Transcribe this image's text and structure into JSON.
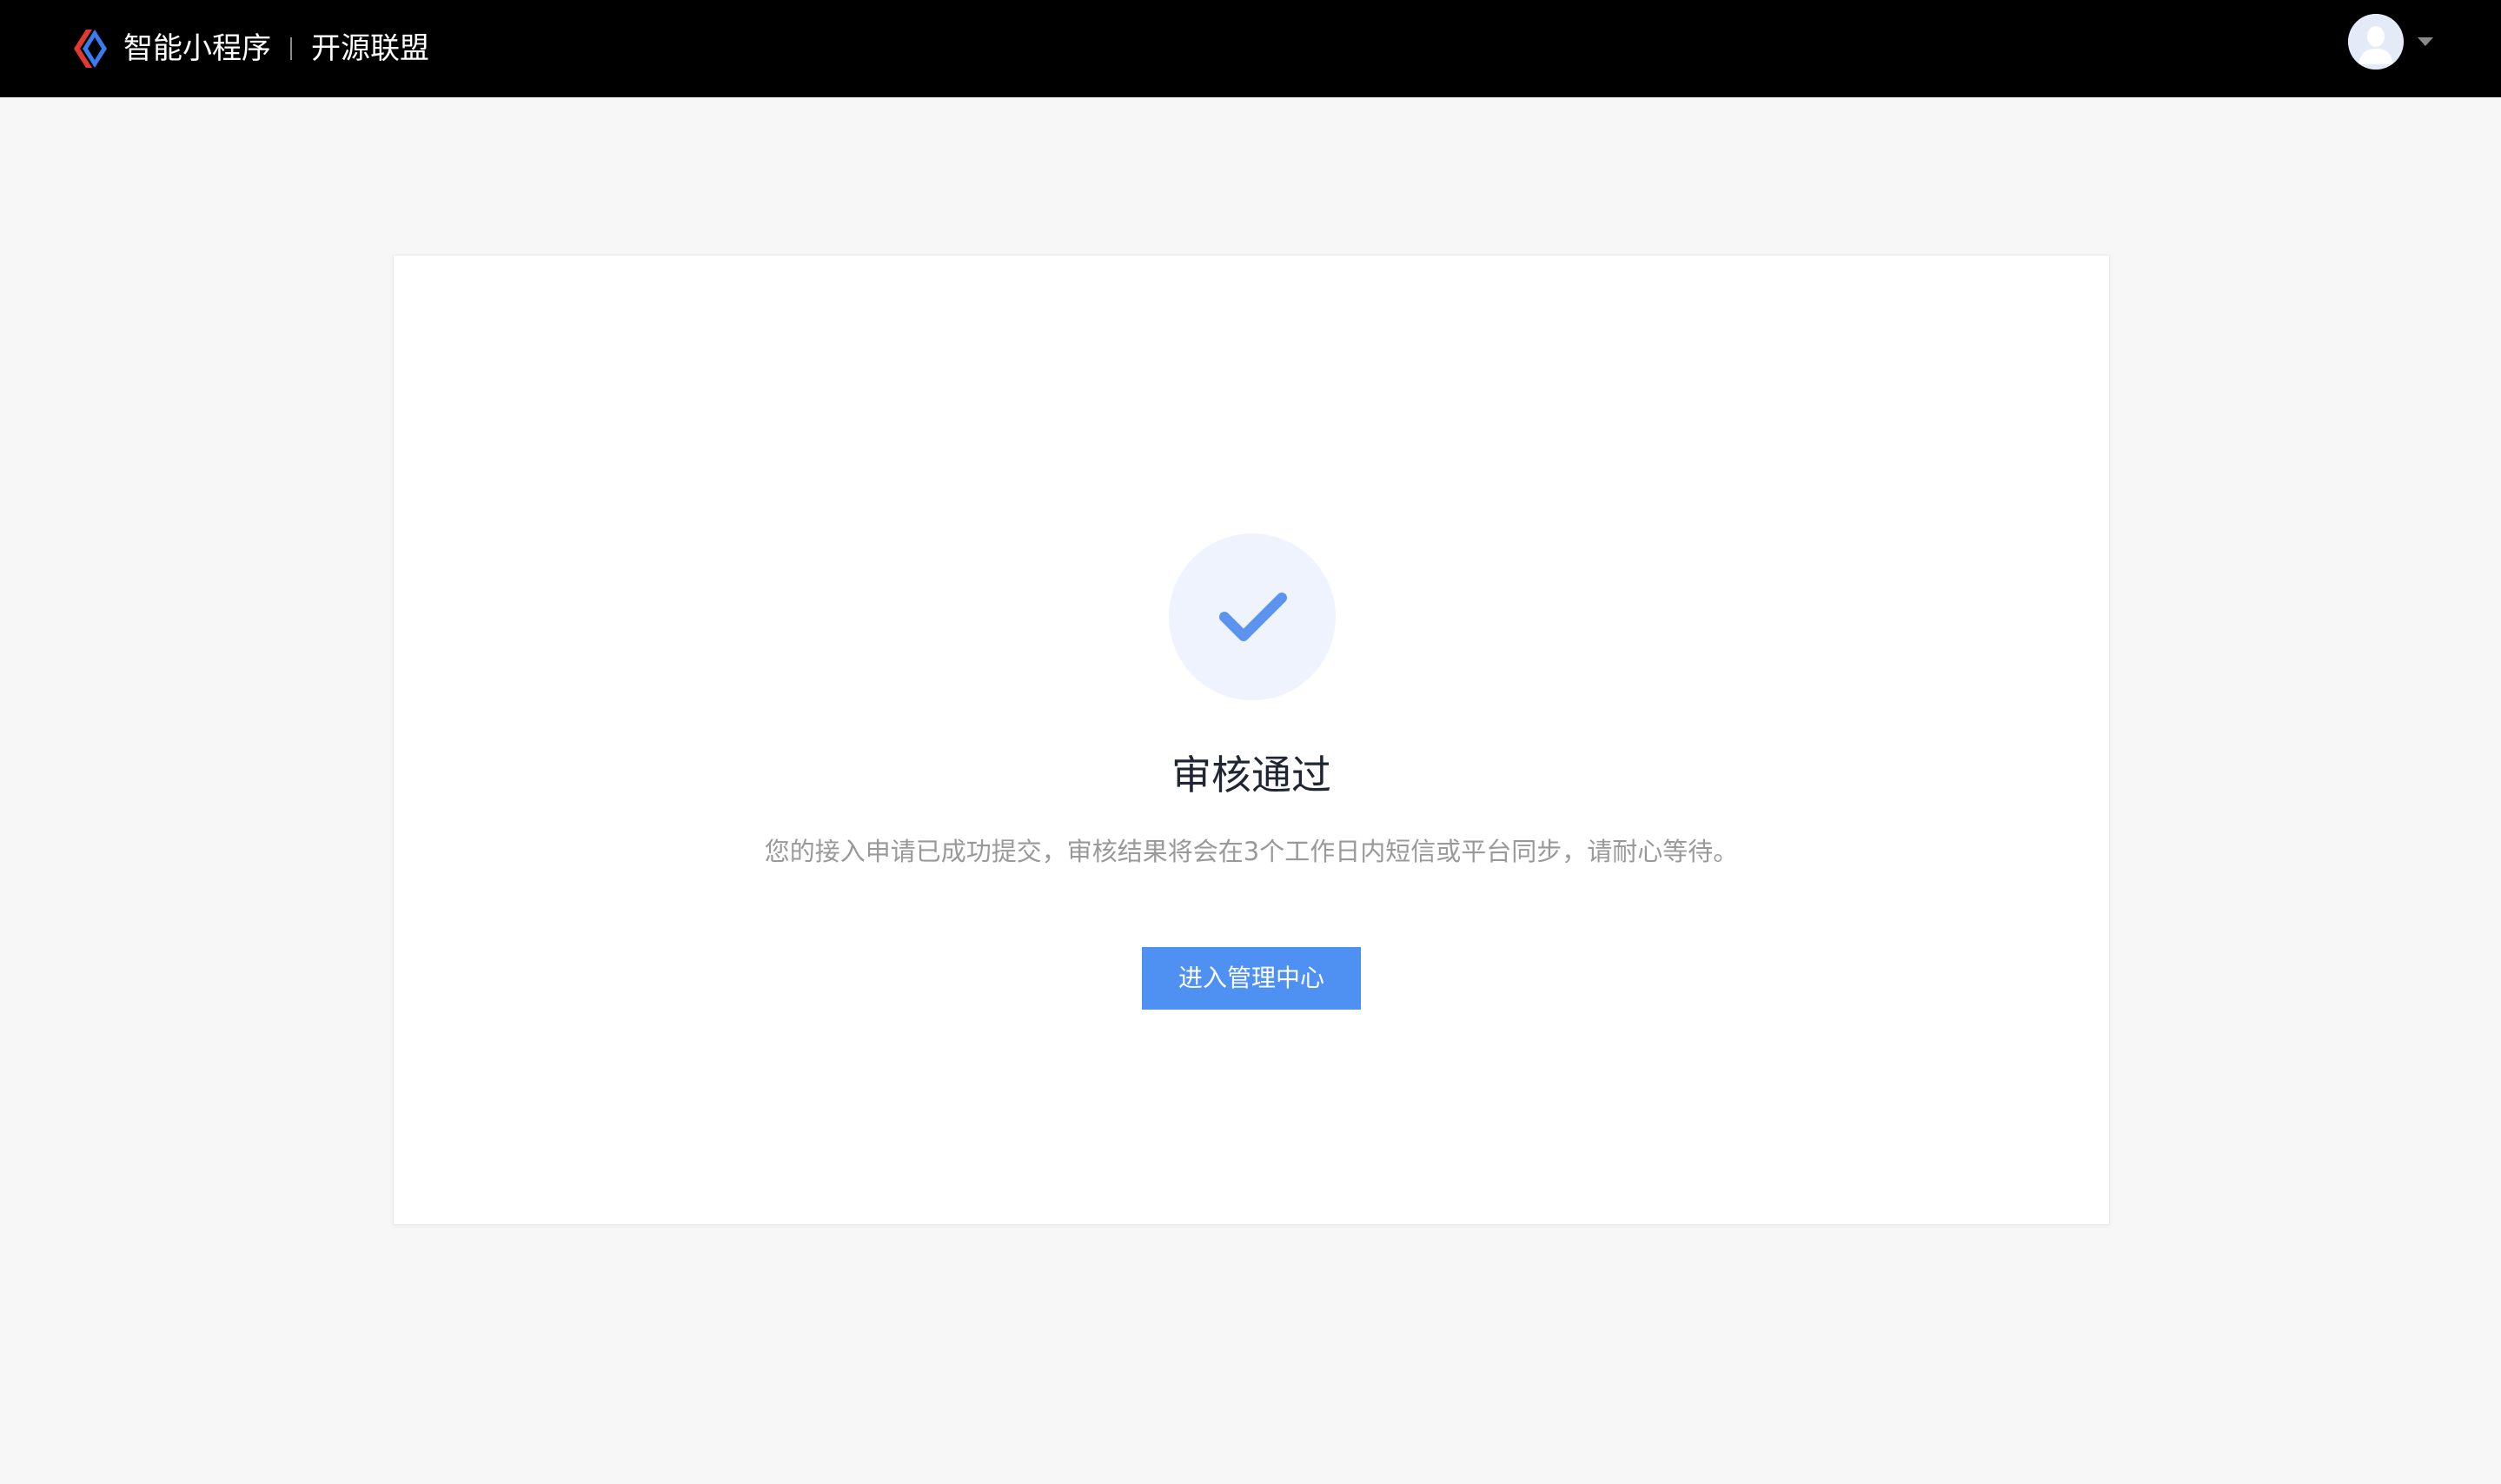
{
  "header": {
    "brand_name": "智能小程序",
    "brand_sub": "开源联盟"
  },
  "user": {
    "avatar_icon": "user-avatar-icon",
    "menu_icon": "caret-down-icon"
  },
  "result": {
    "status_icon": "check-icon",
    "title": "审核通过",
    "description": "您的接入申请已成功提交，审核结果将会在3个工作日内短信或平台同步，请耐心等待。",
    "button_label": "进入管理中心"
  },
  "colors": {
    "header_bg": "#000000",
    "page_bg": "#f7f7f7",
    "primary": "#4e91f2",
    "success_icon": "#5b93ee",
    "icon_circle_bg": "#eef3fd",
    "logo_red": "#e2392f",
    "logo_blue": "#3a7bf0"
  }
}
